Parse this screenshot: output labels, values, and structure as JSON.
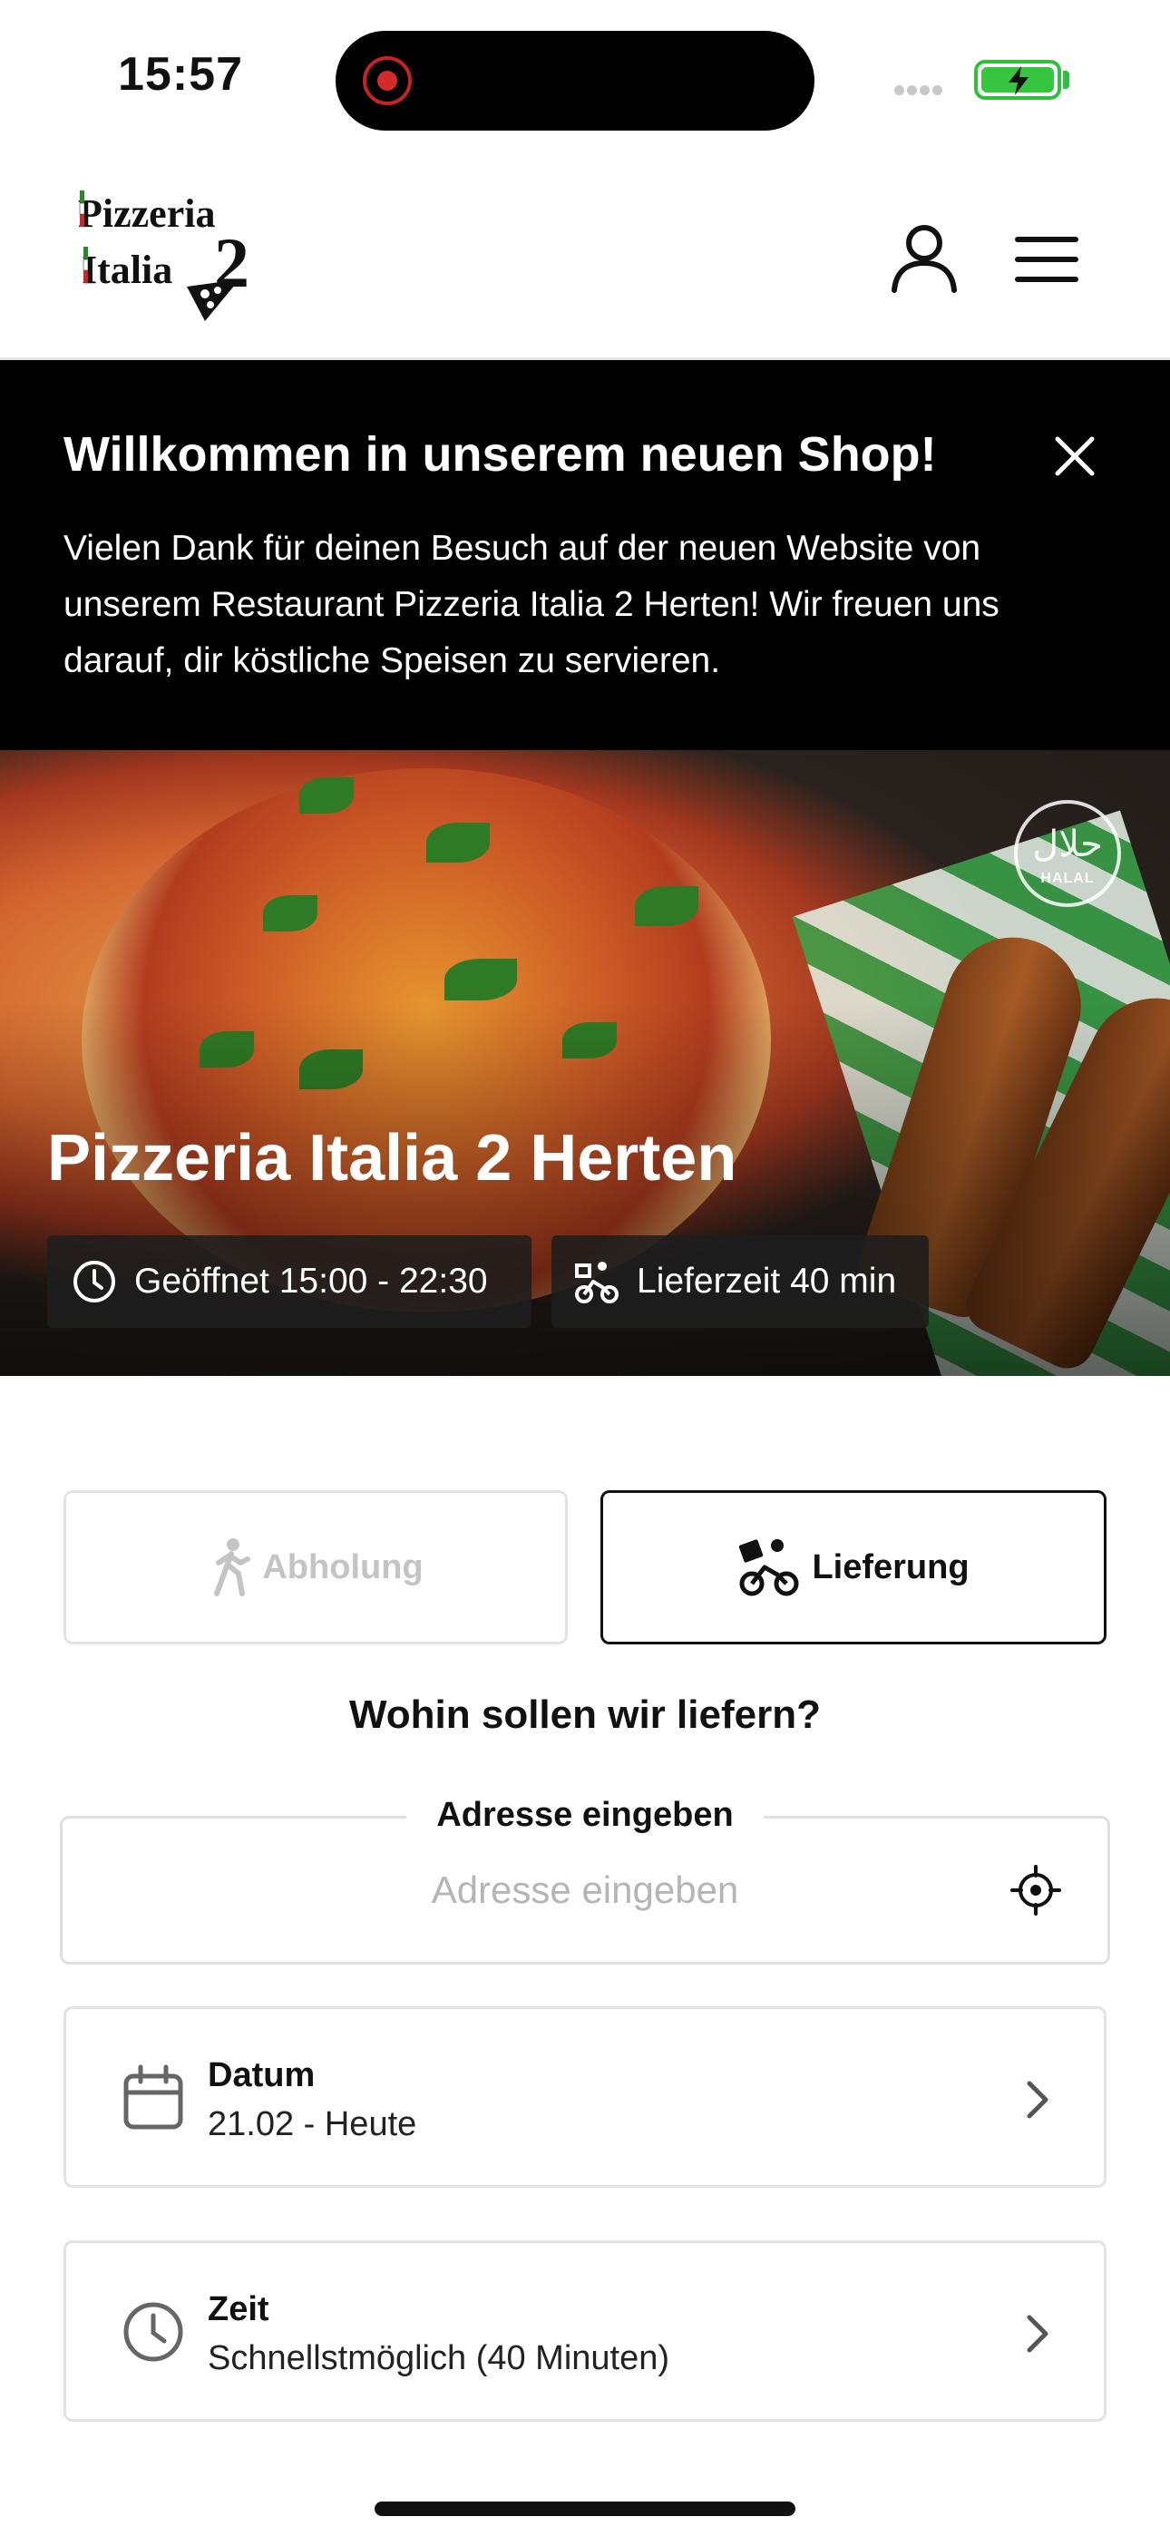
{
  "status_bar": {
    "time": "15:57"
  },
  "header": {
    "logo_line1": "Pizzeria",
    "logo_line2": "Italia",
    "logo_mark": "2",
    "account_icon": "user-icon",
    "menu_icon": "hamburger-menu-icon"
  },
  "banner": {
    "title": "Willkommen in unserem neuen Shop!",
    "text": "Vielen Dank für deinen Besuch auf der neuen Website von unserem Restaurant Pizzeria Italia 2 Herten! Wir freuen uns darauf, dir köstliche Speisen zu servieren."
  },
  "hero": {
    "restaurant_name": "Pizzeria Italia 2 Herten",
    "opening_hours": "Geöffnet 15:00 - 22:30",
    "delivery_time": "Lieferzeit 40 min",
    "halal_arabic": "حلال",
    "halal_label": "HALAL"
  },
  "order_mode": {
    "pickup_label": "Abholung",
    "delivery_label": "Lieferung",
    "selected": "Lieferung"
  },
  "delivery": {
    "question": "Wohin sollen wir liefern?",
    "address_label": "Adresse eingeben",
    "address_placeholder": "Adresse eingeben",
    "address_value": ""
  },
  "date": {
    "label": "Datum",
    "value": "21.02 - Heute"
  },
  "time": {
    "label": "Zeit",
    "value": "Schnellstmöglich (40 Minuten)"
  },
  "colors": {
    "accent": "#111111",
    "banner_bg": "#000000",
    "battery": "#35c53f",
    "record": "#d42a2a"
  }
}
